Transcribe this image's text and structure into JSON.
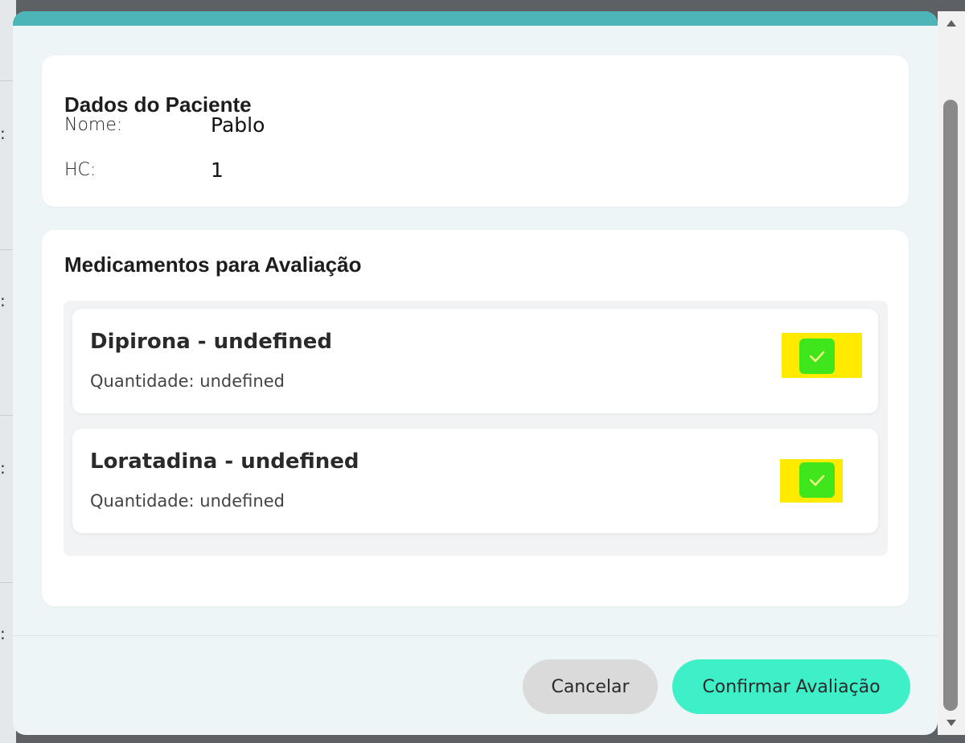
{
  "background": {
    "colon_glyph": ":"
  },
  "patient_card": {
    "title": "Dados do Paciente",
    "name_label": "Nome:",
    "name_value": "Pablo",
    "hc_label": "HC:",
    "hc_value": "1"
  },
  "meds_card": {
    "title": "Medicamentos para Avaliação",
    "items": [
      {
        "name": "Dipirona - undefined",
        "quantity": "Quantidade: undefined",
        "checked": true
      },
      {
        "name": "Loratadina - undefined",
        "quantity": "Quantidade: undefined",
        "checked": true
      }
    ]
  },
  "footer": {
    "cancel_label": "Cancelar",
    "confirm_label": "Confirmar Avaliação"
  },
  "colors": {
    "accent_topbar": "#4db5b8",
    "confirm_button": "#3ef0c8",
    "checkbox_fill": "#3ee61b",
    "highlight": "#ffea00"
  },
  "icons": {
    "checkbox": "check-icon",
    "scroll_up": "scroll-up-arrow-icon",
    "scroll_down": "scroll-down-arrow-icon"
  }
}
